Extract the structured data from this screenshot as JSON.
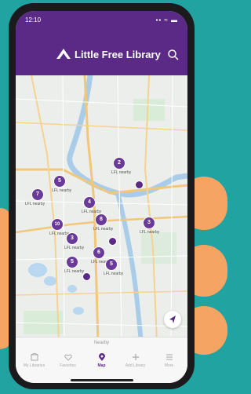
{
  "status": {
    "time": "12:10",
    "signal": "▪▪ ≈ ▬"
  },
  "header": {
    "app_name": "Little Free Library"
  },
  "map": {
    "pins": [
      {
        "count": "2",
        "label": "LFL nearby"
      },
      {
        "count": "5",
        "label": "LFL nearby"
      },
      {
        "count": "7",
        "label": "LFL nearby"
      },
      {
        "count": "4",
        "label": "LFL nearby"
      },
      {
        "count": "10",
        "label": "LFL nearby"
      },
      {
        "count": "8",
        "label": "LFL nearby"
      },
      {
        "count": "3",
        "label": "LFL nearby"
      },
      {
        "count": "3",
        "label": "LFL nearby"
      },
      {
        "count": "5",
        "label": "LFL nearby"
      },
      {
        "count": "6",
        "label": "LFL nearby"
      },
      {
        "count": "5",
        "label": "LFL nearby"
      }
    ]
  },
  "sheet": {
    "label": "Nearby"
  },
  "tabs": [
    {
      "label": "My Libraries",
      "icon": "library-icon"
    },
    {
      "label": "Favorites",
      "icon": "heart-icon"
    },
    {
      "label": "Map",
      "icon": "map-pin-icon"
    },
    {
      "label": "Add Library",
      "icon": "plus-icon"
    },
    {
      "label": "More",
      "icon": "menu-icon"
    }
  ],
  "colors": {
    "brand": "#5a2a86",
    "background": "#21a3a1",
    "accent": "#f5a463"
  }
}
